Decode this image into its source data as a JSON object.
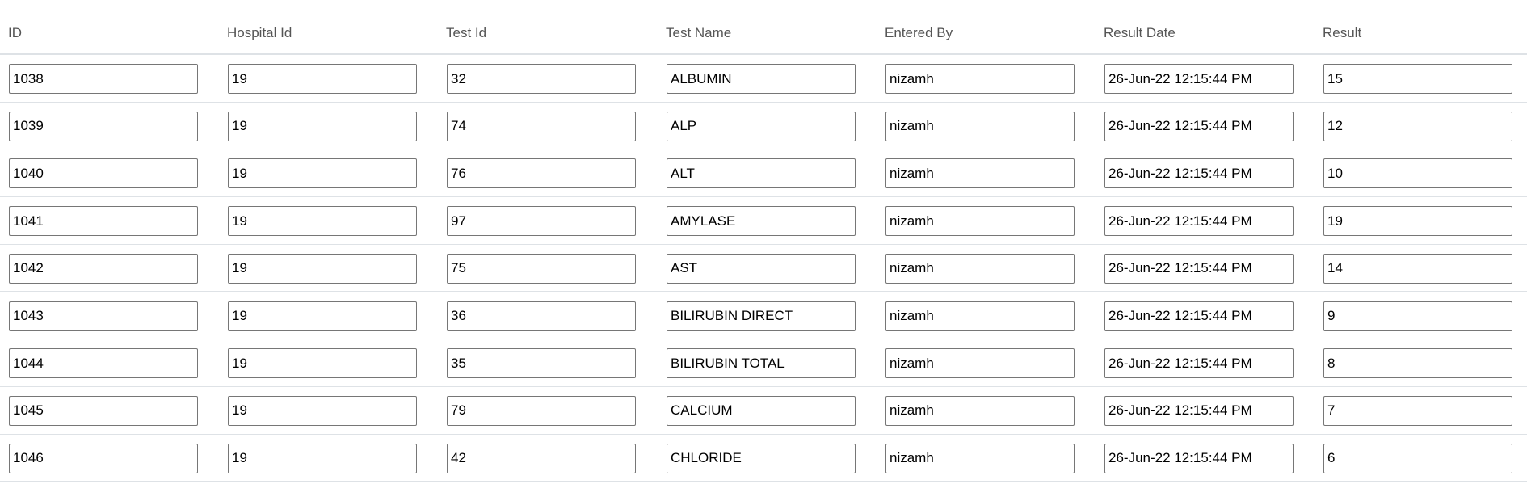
{
  "table": {
    "columns": [
      {
        "key": "id",
        "label": "ID"
      },
      {
        "key": "hospital_id",
        "label": "Hospital Id"
      },
      {
        "key": "test_id",
        "label": "Test Id"
      },
      {
        "key": "test_name",
        "label": "Test Name"
      },
      {
        "key": "entered_by",
        "label": "Entered By"
      },
      {
        "key": "result_date",
        "label": "Result Date"
      },
      {
        "key": "result",
        "label": "Result"
      }
    ],
    "rows": [
      {
        "id": "1038",
        "hospital_id": "19",
        "test_id": "32",
        "test_name": "ALBUMIN",
        "entered_by": "nizamh",
        "result_date": "26-Jun-22 12:15:44 PM",
        "result": "15"
      },
      {
        "id": "1039",
        "hospital_id": "19",
        "test_id": "74",
        "test_name": "ALP",
        "entered_by": "nizamh",
        "result_date": "26-Jun-22 12:15:44 PM",
        "result": "12"
      },
      {
        "id": "1040",
        "hospital_id": "19",
        "test_id": "76",
        "test_name": "ALT",
        "entered_by": "nizamh",
        "result_date": "26-Jun-22 12:15:44 PM",
        "result": "10"
      },
      {
        "id": "1041",
        "hospital_id": "19",
        "test_id": "97",
        "test_name": "AMYLASE",
        "entered_by": "nizamh",
        "result_date": "26-Jun-22 12:15:44 PM",
        "result": "19"
      },
      {
        "id": "1042",
        "hospital_id": "19",
        "test_id": "75",
        "test_name": "AST",
        "entered_by": "nizamh",
        "result_date": "26-Jun-22 12:15:44 PM",
        "result": "14"
      },
      {
        "id": "1043",
        "hospital_id": "19",
        "test_id": "36",
        "test_name": "BILIRUBIN DIRECT",
        "entered_by": "nizamh",
        "result_date": "26-Jun-22 12:15:44 PM",
        "result": "9"
      },
      {
        "id": "1044",
        "hospital_id": "19",
        "test_id": "35",
        "test_name": "BILIRUBIN TOTAL",
        "entered_by": "nizamh",
        "result_date": "26-Jun-22 12:15:44 PM",
        "result": "8"
      },
      {
        "id": "1045",
        "hospital_id": "19",
        "test_id": "79",
        "test_name": "CALCIUM",
        "entered_by": "nizamh",
        "result_date": "26-Jun-22 12:15:44 PM",
        "result": "7"
      },
      {
        "id": "1046",
        "hospital_id": "19",
        "test_id": "42",
        "test_name": "CHLORIDE",
        "entered_by": "nizamh",
        "result_date": "26-Jun-22 12:15:44 PM",
        "result": "6"
      }
    ]
  }
}
